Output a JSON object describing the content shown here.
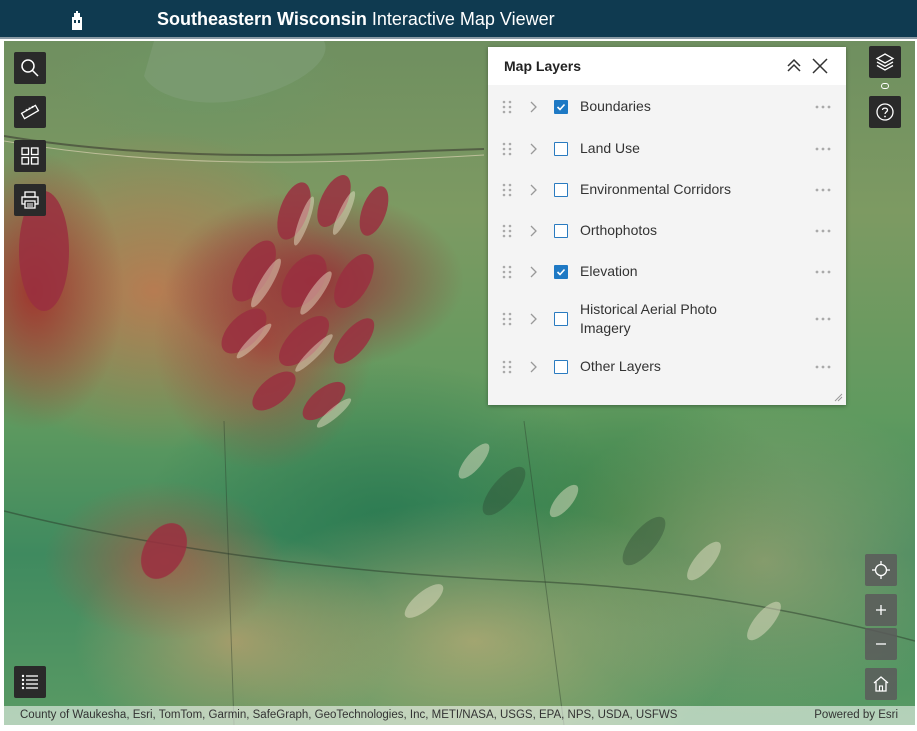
{
  "header": {
    "title_bold": "Southeastern Wisconsin",
    "title_rest": " Interactive Map Viewer",
    "logo_icon": "building-logo-icon"
  },
  "toolbar_left": [
    {
      "name": "search",
      "icon": "search-icon"
    },
    {
      "name": "measure",
      "icon": "ruler-icon"
    },
    {
      "name": "basemap",
      "icon": "grid-icon"
    },
    {
      "name": "print",
      "icon": "printer-icon"
    }
  ],
  "toolbar_right": [
    {
      "name": "layers",
      "icon": "layers-icon"
    },
    {
      "name": "help",
      "icon": "help-icon"
    }
  ],
  "map_controls": [
    "locate-icon",
    "zoom-in-icon",
    "zoom-out-icon",
    "home-icon",
    "legend-list-icon"
  ],
  "layers_panel": {
    "title": "Map Layers",
    "layers": [
      {
        "label": "Boundaries",
        "checked": true
      },
      {
        "label": "Land Use",
        "checked": false
      },
      {
        "label": "Environmental Corridors",
        "checked": false
      },
      {
        "label": "Orthophotos",
        "checked": false
      },
      {
        "label": "Elevation",
        "checked": true
      },
      {
        "label": "Historical Aerial Photo Imagery",
        "checked": false
      },
      {
        "label": "Other Layers",
        "checked": false
      }
    ]
  },
  "attribution": {
    "sources": "County of Waukesha, Esri, TomTom, Garmin, SafeGraph, GeoTechnologies, Inc, METI/NASA, USGS, EPA, NPS, USDA, USFWS",
    "powered_by": "Powered by Esri"
  },
  "colors": {
    "header_bg": "#0f3a50",
    "accent": "#1e79c4"
  }
}
